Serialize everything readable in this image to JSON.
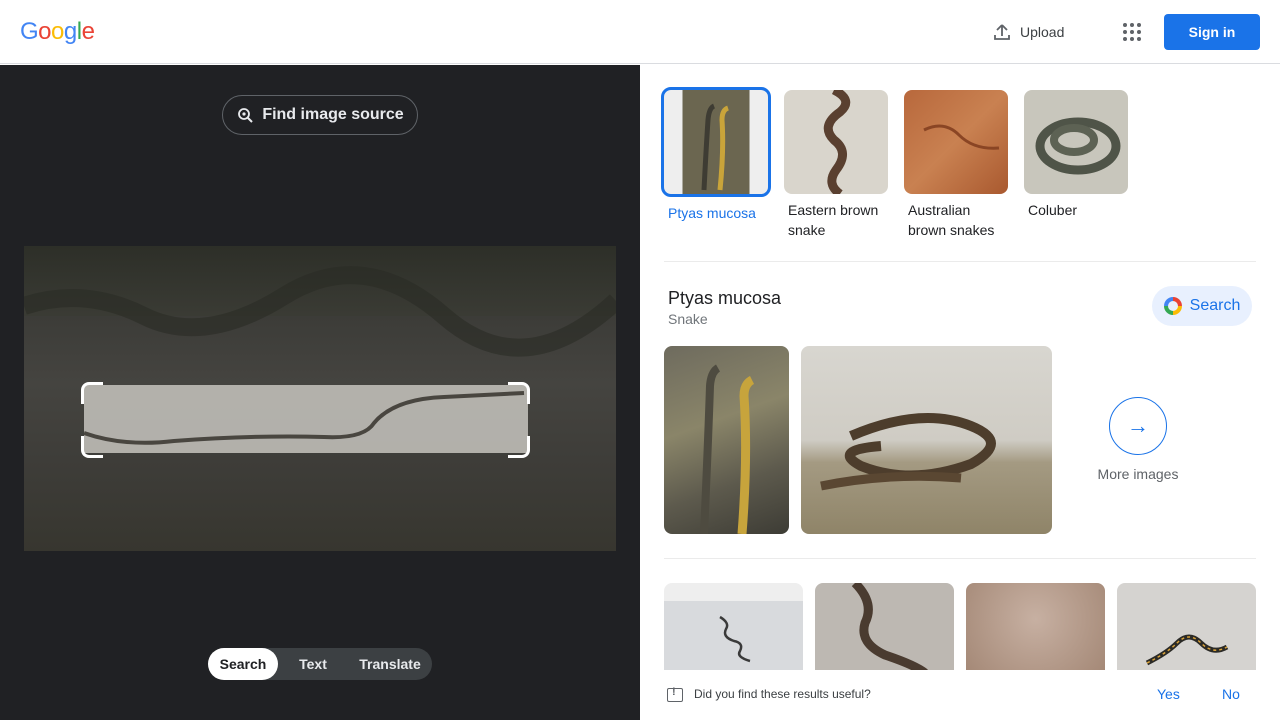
{
  "header": {
    "logo_letters": [
      {
        "char": "G",
        "color": "#4285f4"
      },
      {
        "char": "o",
        "color": "#ea4335"
      },
      {
        "char": "o",
        "color": "#fbbc05"
      },
      {
        "char": "g",
        "color": "#4285f4"
      },
      {
        "char": "l",
        "color": "#34a853"
      },
      {
        "char": "e",
        "color": "#ea4335"
      }
    ],
    "upload_label": "Upload",
    "upload_icon": "upload-icon",
    "apps_icon": "apps-grid-icon",
    "signin_label": "Sign in"
  },
  "left_panel": {
    "find_source_label": "Find image source",
    "find_source_icon": "lens-search-icon",
    "modes": [
      {
        "label": "Search",
        "active": true
      },
      {
        "label": "Text",
        "active": false
      },
      {
        "label": "Translate",
        "active": false
      }
    ]
  },
  "chips": [
    {
      "label": "Ptyas mucosa",
      "selected": true
    },
    {
      "label": "Eastern brown snake",
      "selected": false
    },
    {
      "label": "Australian brown snakes",
      "selected": false
    },
    {
      "label": "Coluber",
      "selected": false
    }
  ],
  "knowledge_panel": {
    "title": "Ptyas mucosa",
    "subtitle": "Snake",
    "search_label": "Search",
    "more_images_label": "More images",
    "more_images_icon": "arrow-right-icon"
  },
  "feedback": {
    "question": "Did you find these results useful?",
    "yes_label": "Yes",
    "no_label": "No",
    "icon": "feedback-icon"
  },
  "colors": {
    "accent": "#1a73e8",
    "left_bg": "#202124"
  }
}
